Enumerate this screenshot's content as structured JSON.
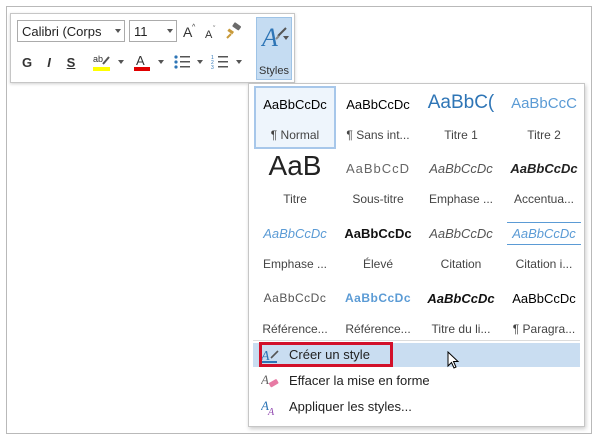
{
  "toolbar": {
    "font_name": "Calibri (Corps",
    "font_size": "11",
    "bold": "G",
    "italic": "I",
    "underline": "S",
    "styles_label": "Styles",
    "highlight_color": "#ffff00",
    "font_color": "#e00000"
  },
  "gallery": {
    "tiles": [
      {
        "preview": "AaBbCcDc",
        "label": "¶ Normal"
      },
      {
        "preview": "AaBbCcDc",
        "label": "¶ Sans int..."
      },
      {
        "preview": "AaBbC(",
        "label": "Titre 1"
      },
      {
        "preview": "AaBbCcC",
        "label": "Titre 2"
      },
      {
        "preview": "AaB",
        "label": "Titre"
      },
      {
        "preview": "AaBbCcD",
        "label": "Sous-titre"
      },
      {
        "preview": "AaBbCcDc",
        "label": "Emphase ..."
      },
      {
        "preview": "AaBbCcDc",
        "label": "Accentua..."
      },
      {
        "preview": "AaBbCcDc",
        "label": "Emphase ..."
      },
      {
        "preview": "AaBbCcDc",
        "label": "Élevé"
      },
      {
        "preview": "AaBbCcDc",
        "label": "Citation"
      },
      {
        "preview": "AaBbCcDc",
        "label": "Citation i..."
      },
      {
        "preview": "AaBbCcDc",
        "label": "Référence..."
      },
      {
        "preview": "AaBbCcDc",
        "label": "Référence..."
      },
      {
        "preview": "AaBbCcDc",
        "label": "Titre du li..."
      },
      {
        "preview": "AaBbCcDc",
        "label": "¶ Paragra..."
      }
    ]
  },
  "menu": {
    "create_style": "Créer un style",
    "clear_formatting": "Effacer la mise en forme",
    "apply_styles": "Appliquer les styles..."
  },
  "colors": {
    "accent_blue": "#5b9bd5",
    "hover": "#c9ddf1",
    "highlight_box": "#d2102a"
  }
}
